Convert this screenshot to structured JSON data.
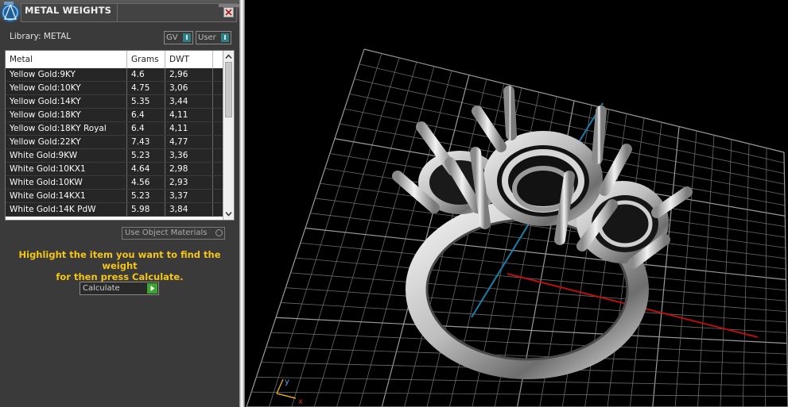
{
  "panel": {
    "title": "METAL WEIGHTS",
    "library_label": "Library: METAL",
    "toggles": [
      {
        "label": "GV",
        "indicator": "I"
      },
      {
        "label": "User",
        "indicator": "I"
      }
    ],
    "table": {
      "columns": [
        "Metal",
        "Grams",
        "DWT"
      ],
      "rows": [
        [
          "Yellow Gold:9KY",
          "4.6",
          "2,96"
        ],
        [
          "Yellow Gold:10KY",
          "4.75",
          "3,06"
        ],
        [
          "Yellow Gold:14KY",
          "5.35",
          "3,44"
        ],
        [
          "Yellow Gold:18KY",
          "6.4",
          "4,11"
        ],
        [
          "Yellow Gold:18KY Royal",
          "6.4",
          "4,11"
        ],
        [
          "Yellow Gold:22KY",
          "7.43",
          "4,77"
        ],
        [
          "White Gold:9KW",
          "5.23",
          "3,36"
        ],
        [
          "White Gold:10KX1",
          "4.64",
          "2,98"
        ],
        [
          "White Gold:10KW",
          "4.56",
          "2,93"
        ],
        [
          "White Gold:14KX1",
          "5.23",
          "3,37"
        ],
        [
          "White Gold:14K PdW",
          "5.98",
          "3,84"
        ]
      ]
    },
    "use_object_materials": "Use Object Materials",
    "instruction_line1": "Highlight the item you want to find the weight",
    "instruction_line2": "for then press Calculate.",
    "calculate_label": "Calculate"
  },
  "viewport": {
    "axis_labels": {
      "x": "x",
      "y": "y"
    }
  },
  "colors": {
    "accent_text": "#f5c516",
    "toggle_on": "#2f7f87",
    "go_button": "#3aa62f",
    "x_axis": "#b80f0f",
    "y_axis": "#1d7fa8"
  },
  "icons": [
    "app-logo-icon",
    "close-icon",
    "scroll-up-icon",
    "scroll-down-icon",
    "play-icon"
  ]
}
